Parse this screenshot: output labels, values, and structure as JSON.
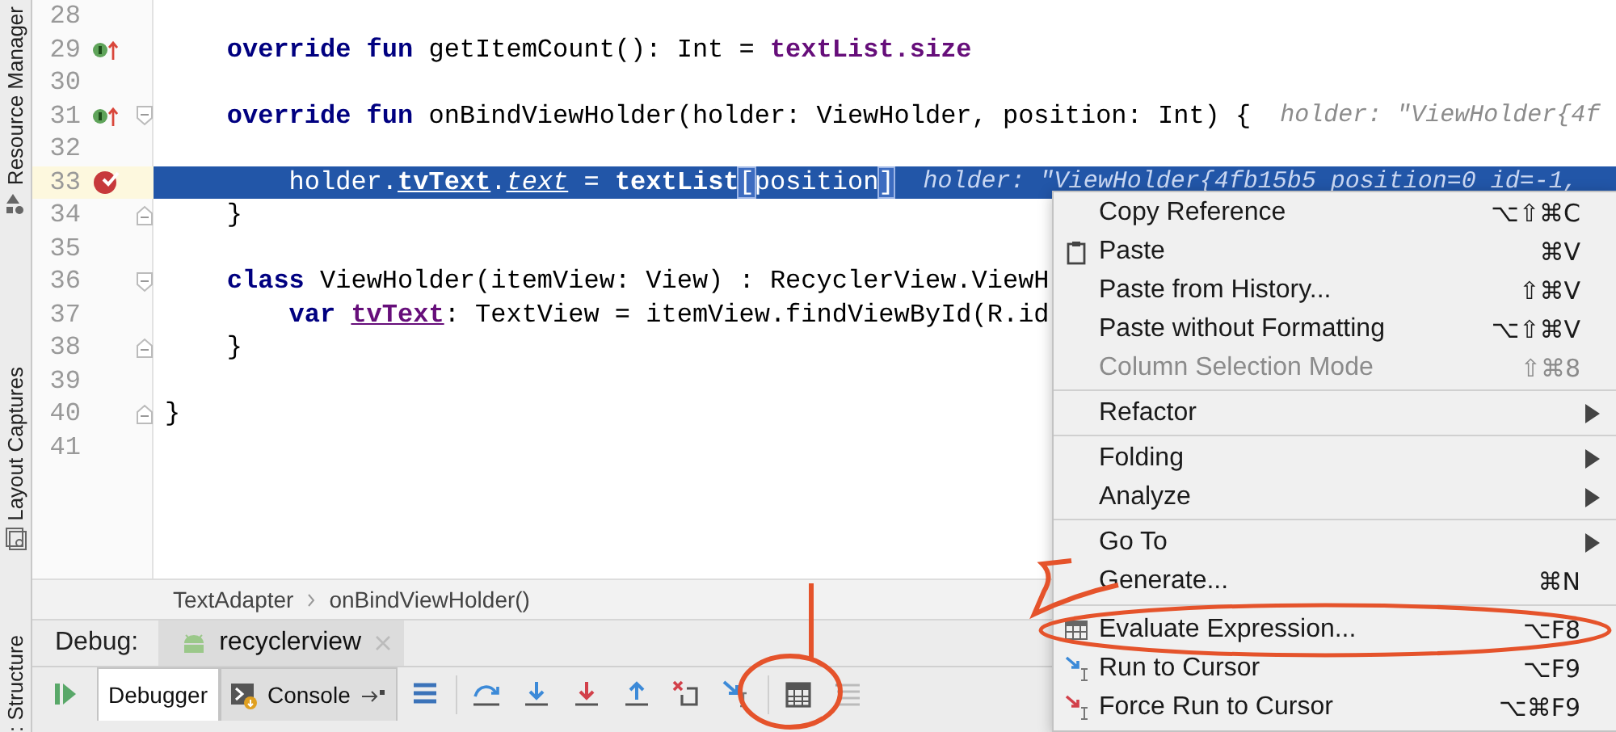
{
  "side_tabs": [
    {
      "label": "Resource Manager"
    },
    {
      "label": "Layout Captures"
    },
    {
      "label": ": Structure"
    }
  ],
  "editor": {
    "lines": [
      {
        "number": "28",
        "current": false
      },
      {
        "number": "29",
        "current": false,
        "gutter_icon": {
          "kind": "override"
        },
        "segments": [
          {
            "text": "    override fun",
            "kind": "keyword"
          },
          {
            "text": " getItemCount(): Int = ",
            "kind": "plain"
          },
          {
            "text": "textList.size",
            "kind": "field"
          }
        ]
      },
      {
        "number": "30",
        "current": false
      },
      {
        "number": "31",
        "current": false,
        "gutter_icon": {
          "kind": "override"
        },
        "fold_mark": {
          "kind": "start"
        },
        "segments": [
          {
            "text": "    override fun",
            "kind": "keyword"
          },
          {
            "text": " onBindViewHolder(holder: ViewHolder, position: Int) {",
            "kind": "plain"
          }
        ],
        "hint": "holder: \"ViewHolder{4f"
      },
      {
        "number": "32",
        "current": false
      },
      {
        "number": "33",
        "current": true,
        "gutter_icon": {
          "kind": "breakpoint"
        },
        "segments": [
          {
            "text": "        holder.",
            "kind": "plain"
          },
          {
            "text": "tvText",
            "kind": "field_underlined"
          },
          {
            "text": ".",
            "kind": "plain"
          },
          {
            "text": "text",
            "kind": "extension"
          },
          {
            "text": " = ",
            "kind": "plain"
          },
          {
            "text": "textList",
            "kind": "field"
          },
          {
            "text": "[",
            "kind": "bracket"
          },
          {
            "text": "position",
            "kind": "plain"
          },
          {
            "text": "]",
            "kind": "bracket"
          }
        ],
        "hint": "holder: \"ViewHolder{4fb15b5 position=0 id=-1,"
      },
      {
        "number": "34",
        "current": false,
        "fold_mark": {
          "kind": "end"
        },
        "segments": [
          {
            "text": "    }",
            "kind": "plain"
          }
        ]
      },
      {
        "number": "35",
        "current": false
      },
      {
        "number": "36",
        "current": false,
        "fold_mark": {
          "kind": "start"
        },
        "segments": [
          {
            "text": "    class",
            "kind": "keyword"
          },
          {
            "text": " ViewHolder(itemView: View) : RecyclerView.ViewH",
            "kind": "plain"
          }
        ]
      },
      {
        "number": "37",
        "current": false,
        "segments": [
          {
            "text": "        var ",
            "kind": "keyword"
          },
          {
            "text": "tvText",
            "kind": "field_underlined"
          },
          {
            "text": ": TextView = itemView.findViewById(R.id",
            "kind": "plain"
          }
        ]
      },
      {
        "number": "38",
        "current": false,
        "fold_mark": {
          "kind": "end"
        },
        "segments": [
          {
            "text": "    }",
            "kind": "plain"
          }
        ]
      },
      {
        "number": "39",
        "current": false
      },
      {
        "number": "40",
        "current": false,
        "fold_mark": {
          "kind": "end"
        },
        "segments": [
          {
            "text": "}",
            "kind": "plain"
          }
        ]
      },
      {
        "number": "41",
        "current": false
      }
    ]
  },
  "breadcrumb": [
    "TextAdapter",
    "onBindViewHolder()"
  ],
  "debug": {
    "label": "Debug:",
    "session_tab": {
      "label": "recyclerview"
    },
    "tabs": [
      {
        "label": "Debugger",
        "selected": true
      },
      {
        "label": "Console",
        "selected": false
      }
    ]
  },
  "context_menu": {
    "groups": [
      [
        {
          "label": "Copy Reference",
          "shortcut": "⌥⇧⌘C",
          "disabled": false,
          "kind": "command"
        },
        {
          "label": "Paste",
          "shortcut": "⌘V",
          "disabled": false,
          "kind": "clipboard"
        },
        {
          "label": "Paste from History...",
          "shortcut": "⇧⌘V",
          "disabled": false,
          "kind": "command"
        },
        {
          "label": "Paste without Formatting",
          "shortcut": "⌥⇧⌘V",
          "disabled": false,
          "kind": "command"
        },
        {
          "label": "Column Selection Mode",
          "shortcut": "⇧⌘8",
          "disabled": true,
          "kind": "command"
        }
      ],
      [
        {
          "label": "Refactor",
          "disabled": false,
          "kind": "submenu"
        }
      ],
      [
        {
          "label": "Folding",
          "disabled": false,
          "kind": "submenu"
        },
        {
          "label": "Analyze",
          "disabled": false,
          "kind": "submenu"
        }
      ],
      [
        {
          "label": "Go To",
          "disabled": false,
          "kind": "submenu"
        },
        {
          "label": "Generate...",
          "shortcut": "⌘N",
          "disabled": false,
          "kind": "command"
        }
      ],
      [
        {
          "label": "Evaluate Expression...",
          "shortcut": "⌥F8",
          "disabled": false,
          "kind": "evaluate"
        },
        {
          "label": "Run to Cursor",
          "shortcut": "⌥F9",
          "disabled": false,
          "kind": "run_to_cursor"
        },
        {
          "label": "Force Run to Cursor",
          "shortcut": "⌥⌘F9",
          "disabled": false,
          "kind": "force_run_to_cursor"
        }
      ]
    ]
  }
}
